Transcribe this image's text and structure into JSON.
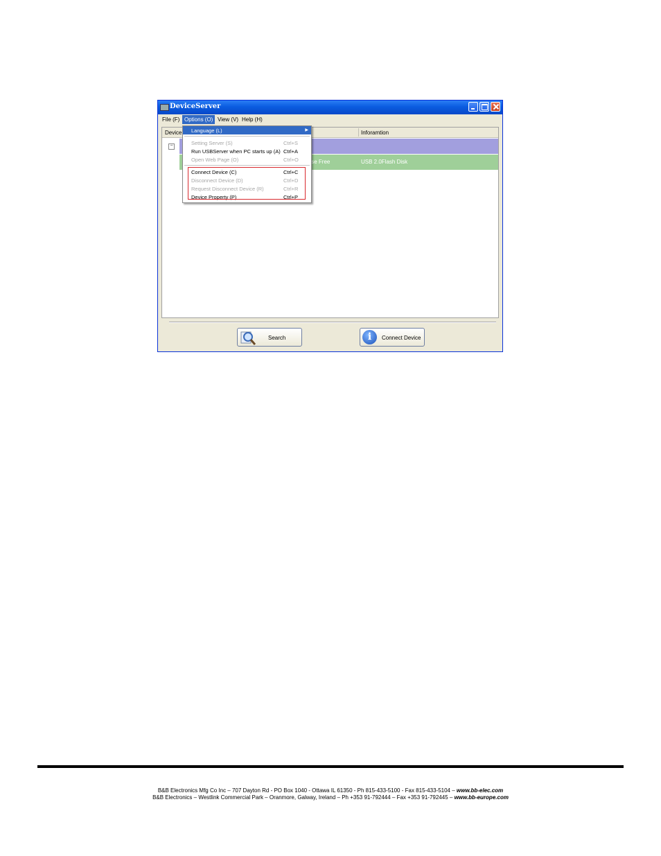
{
  "window": {
    "title": "DeviceServer"
  },
  "menubar": {
    "file": "File (F)",
    "options": "Options (O)",
    "view": "View (V)",
    "help": "Help (H)"
  },
  "list": {
    "col_device": "Device",
    "col_information": "Inforamtion",
    "tree_toggle": "−",
    "row_status": "evise Free",
    "row_info": "USB 2.0Flash Disk"
  },
  "options_menu": {
    "language": "Language (L)",
    "setting_server": {
      "label": "Setting Server (S)",
      "shortcut": "Ctrl+S"
    },
    "run_on_startup": {
      "label": "Run USBServer when PC starts up (A)",
      "shortcut": "Ctrl+A"
    },
    "open_web_page": {
      "label": "Open Web Page (O)",
      "shortcut": "Ctrl+O"
    },
    "connect_device": {
      "label": "Connect Device (C)",
      "shortcut": "Ctrl+C"
    },
    "disconnect_device": {
      "label": "Disconnect Device (D)",
      "shortcut": "Ctrl+D"
    },
    "request_disconnect": {
      "label": "Request Disconnect Device (R)",
      "shortcut": "Ctrl+R"
    },
    "device_property": {
      "label": "Device Property (P)",
      "shortcut": "Ctrl+P"
    }
  },
  "buttons": {
    "search": "Search",
    "connect_device": "Connect Device"
  },
  "footer": {
    "line1": "B&B Electronics Mfg Co Inc – 707 Dayton Rd - PO Box 1040 - Ottawa IL 61350 - Ph 815-433-5100 - Fax 815-433-5104 – ",
    "line1_web": "www.bb-elec.com",
    "line2": "B&B Electronics – Westlink Commercial Park – Oranmore, Galway, Ireland – Ph +353 91-792444 – Fax +353 91-792445 – ",
    "line2_web": "www.bb-europe.com"
  },
  "colors": {
    "titlebar": "#0a5ce0",
    "menu_highlight": "#316ac5",
    "row_purple": "#a29fde",
    "row_green": "#9fcf99",
    "red_box": "#d8282d"
  }
}
